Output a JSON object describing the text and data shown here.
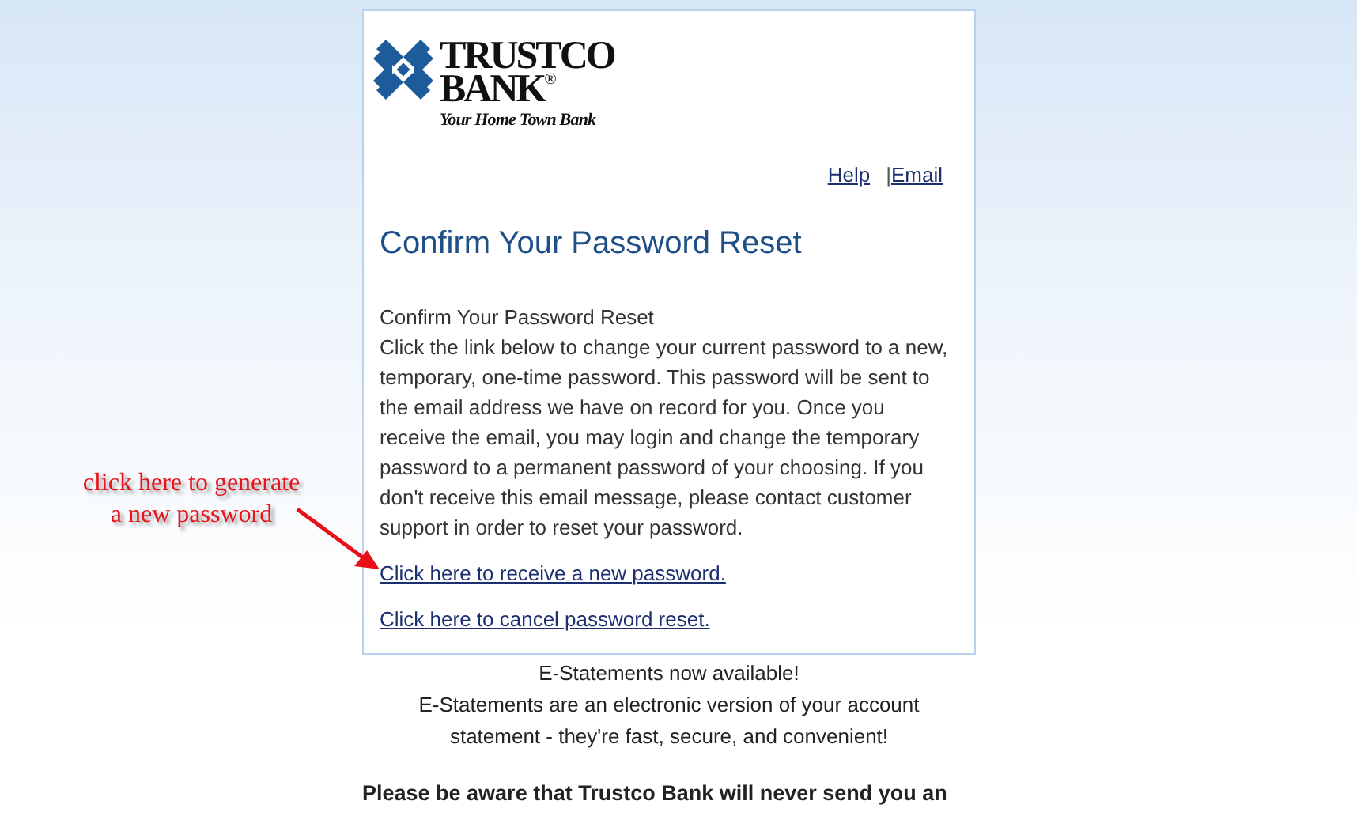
{
  "logo": {
    "name_line_1": "TRUSTCO",
    "name_line_2": "BANK",
    "registered": "®",
    "tagline": "Your Home Town Bank"
  },
  "header_links": [
    {
      "label": "Help"
    },
    {
      "label": "Email",
      "separator": "|"
    }
  ],
  "heading": "Confirm Your Password Reset",
  "subheading": "Confirm Your Password Reset",
  "body": "Click the link below to change your current password to a new, temporary, one-time password. This password will be sent to the email address we have on record for you. Once you receive the email, you may login and change the temporary password to a permanent password of your choosing. If you don't receive this email message, please contact customer support in order to reset your password.",
  "links": [
    "Click here to receive a new password.",
    "Click here to cancel password reset."
  ],
  "notice": {
    "title": "E-Statements now available!",
    "text": "E-Statements are an electronic version of your account statement - they're fast, secure, and convenient!"
  },
  "warning": "Please be aware that Trustco Bank will never send you an",
  "annotation": {
    "line_1": "click here to generate",
    "line_2": "a new password"
  }
}
